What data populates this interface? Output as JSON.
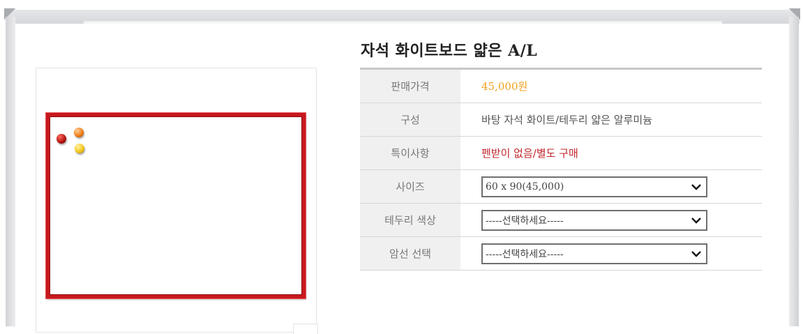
{
  "product": {
    "title": "자석 화이트보드 얇은 A/L"
  },
  "specs": [
    {
      "label": "판매가격",
      "value": "45,000원"
    },
    {
      "label": "구성",
      "value": "바탕 자석 화이트/테두리 얇은 알루미늄"
    },
    {
      "label": "특이사항",
      "value": "펜받이 없음/별도 구매"
    }
  ],
  "options": [
    {
      "label": "사이즈",
      "selected": "60 x 90(45,000)"
    },
    {
      "label": "테두리 색상",
      "selected": "-----선택하세요-----"
    },
    {
      "label": "암선 선택",
      "selected": "-----선택하세요-----"
    }
  ],
  "colors": {
    "price": "#f0a21e",
    "note": "#c1272d",
    "board_frame": "#c8191f"
  }
}
